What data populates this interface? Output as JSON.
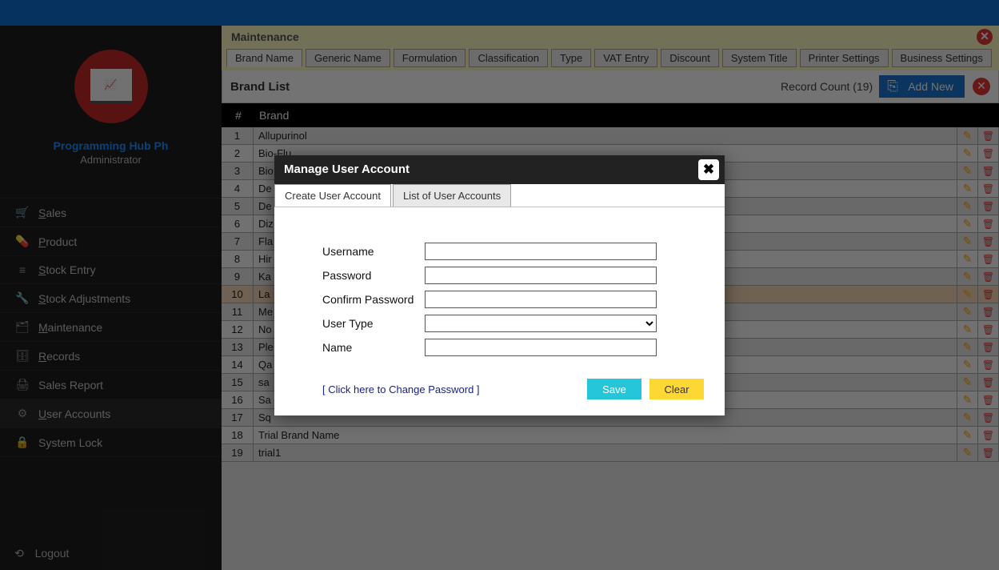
{
  "title_bar": "",
  "sidebar": {
    "brand": "Programming Hub Ph",
    "role": "Administrator",
    "items": [
      {
        "icon": "🛒",
        "label": "Sales",
        "u": "S"
      },
      {
        "icon": "💊",
        "label": "Product",
        "u": "P"
      },
      {
        "icon": "≡",
        "label": "Stock Entry",
        "u": "S"
      },
      {
        "icon": "🔧",
        "label": "Stock Adjustments",
        "u": "S"
      },
      {
        "icon": "🗂",
        "label": "Maintenance",
        "u": "M"
      },
      {
        "icon": "🗄",
        "label": "Records",
        "u": "R"
      },
      {
        "icon": "🖨",
        "label": "Sales Report",
        "u": ""
      },
      {
        "icon": "⚙",
        "label": "User Accounts",
        "u": "U"
      },
      {
        "icon": "🔒",
        "label": "System Lock",
        "u": ""
      }
    ],
    "logout_label": "Logout"
  },
  "maintenance": {
    "header": "Maintenance",
    "tabs": [
      "Brand Name",
      "Generic Name",
      "Formulation",
      "Classification",
      "Type",
      "VAT Entry",
      "Discount",
      "System Title",
      "Printer Settings",
      "Business Settings"
    ],
    "list_title": "Brand List",
    "record_count_label": "Record Count (19)",
    "add_new_label": "Add New",
    "columns": {
      "num": "#",
      "brand": "Brand"
    },
    "rows": [
      {
        "n": "1",
        "brand": "Allupurinol"
      },
      {
        "n": "2",
        "brand": "Bio-Flu"
      },
      {
        "n": "3",
        "brand": "Bio"
      },
      {
        "n": "4",
        "brand": "De"
      },
      {
        "n": "5",
        "brand": "De"
      },
      {
        "n": "6",
        "brand": "Diz"
      },
      {
        "n": "7",
        "brand": "Fla"
      },
      {
        "n": "8",
        "brand": "Hir"
      },
      {
        "n": "9",
        "brand": "Ka"
      },
      {
        "n": "10",
        "brand": "La"
      },
      {
        "n": "11",
        "brand": "Me"
      },
      {
        "n": "12",
        "brand": "No"
      },
      {
        "n": "13",
        "brand": "Ple"
      },
      {
        "n": "14",
        "brand": "Qa"
      },
      {
        "n": "15",
        "brand": "sa"
      },
      {
        "n": "16",
        "brand": "Sa"
      },
      {
        "n": "17",
        "brand": "Sq"
      },
      {
        "n": "18",
        "brand": "Trial Brand Name"
      },
      {
        "n": "19",
        "brand": "trial1"
      }
    ]
  },
  "modal": {
    "title": "Manage User Account",
    "tabs": [
      "Create User Account",
      "List of User Accounts"
    ],
    "fields": {
      "username": "Username",
      "password": "Password",
      "confirm": "Confirm Password",
      "usertype": "User Type",
      "name": "Name"
    },
    "values": {
      "username": "",
      "password": "",
      "confirm": "",
      "usertype": "",
      "name": ""
    },
    "change_pw_link": "[ Click here to Change Password ]",
    "save_label": "Save",
    "clear_label": "Clear"
  }
}
